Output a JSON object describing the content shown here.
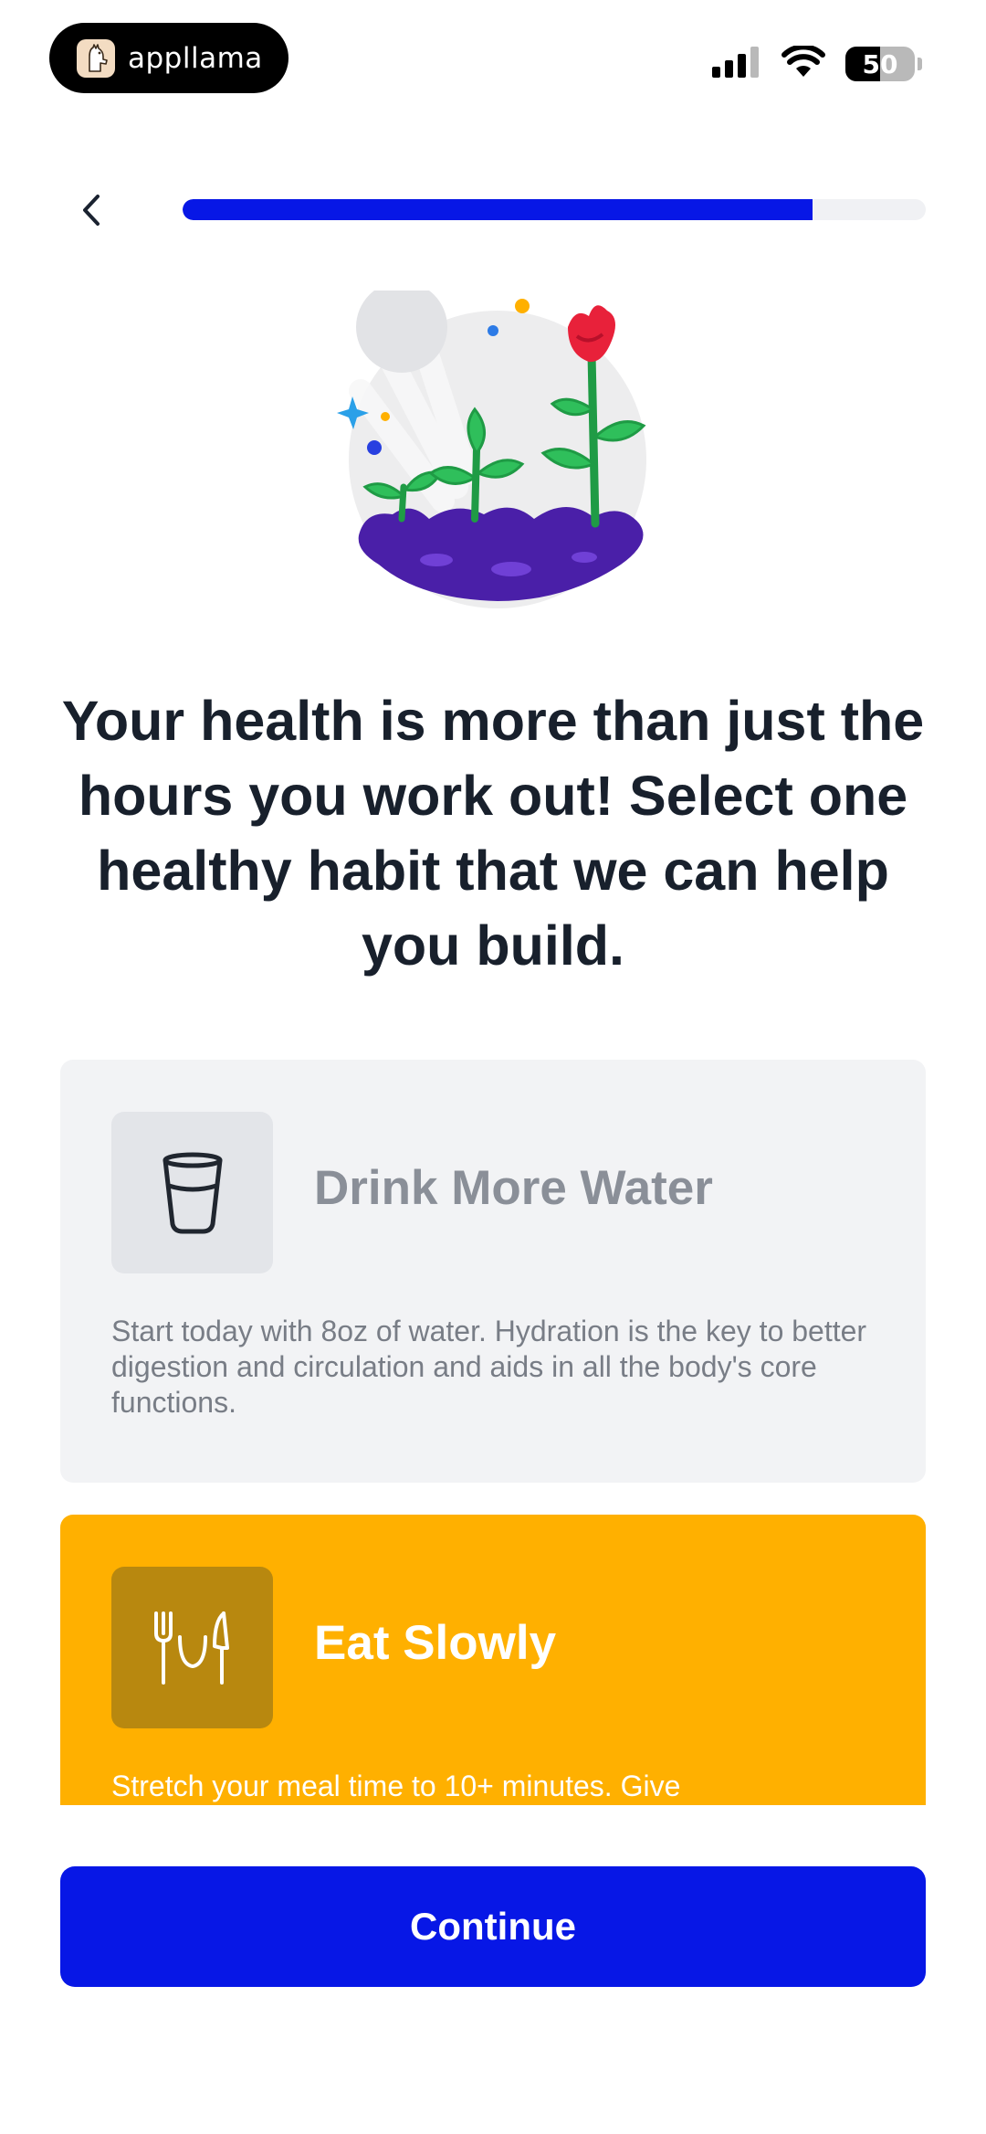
{
  "status_bar": {
    "app_name": "appllama",
    "battery": "50",
    "battery_level_percent": 50,
    "icons": [
      "llama-logo-icon",
      "signal-icon",
      "wifi-icon",
      "battery-icon"
    ]
  },
  "nav": {
    "back_icon": "chevron-left-icon",
    "progress_percent": 84.8
  },
  "hero_icon": "plants-growing-illustration",
  "headline": "Your health is more than just the hours you work out! Select one healthy habit that we can help you build.",
  "habits": [
    {
      "title": "Drink More Water",
      "description": "Start today with 8oz of water. Hydration is the key to better digestion and circulation and aids in all the body's core functions.",
      "icon": "water-glass-icon",
      "selected": false
    },
    {
      "title": "Eat Slowly",
      "description": "Stretch your meal time to 10+ minutes. Give",
      "icon": "fork-plate-knife-icon",
      "selected": true
    }
  ],
  "continue_label": "Continue",
  "colors": {
    "primary": "#0717e6",
    "selected_card": "#ffb000",
    "unselected_card": "#f2f3f5",
    "headline_text": "#18202c"
  }
}
